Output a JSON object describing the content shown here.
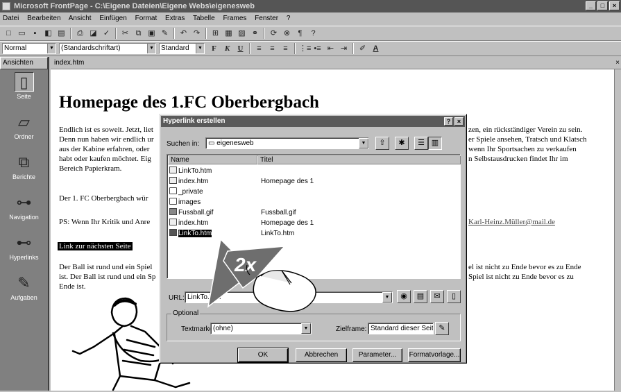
{
  "window": {
    "title": "Microsoft FrontPage - C:\\Eigene Dateien\\Eigene Webs\\eigenesweb",
    "controls": [
      "_",
      "□",
      "×"
    ]
  },
  "menu": [
    "Datei",
    "Bearbeiten",
    "Ansicht",
    "Einfügen",
    "Format",
    "Extras",
    "Tabelle",
    "Frames",
    "Fenster",
    "?"
  ],
  "format_toolbar": {
    "style": "Normal",
    "font": "(Standardschriftart)",
    "size": "Standard",
    "bold": "F",
    "italic": "K",
    "underline": "U"
  },
  "views": {
    "header": "Ansichten",
    "items": [
      {
        "label": "Seite",
        "icon": "page-icon"
      },
      {
        "label": "Ordner",
        "icon": "folder-icon"
      },
      {
        "label": "Berichte",
        "icon": "reports-icon"
      },
      {
        "label": "Navigation",
        "icon": "navigation-icon"
      },
      {
        "label": "Hyperlinks",
        "icon": "hyperlinks-icon"
      },
      {
        "label": "Aufgaben",
        "icon": "tasks-icon"
      }
    ]
  },
  "doc": {
    "tab": "index.htm",
    "close": "×",
    "heading": "Homepage des 1.FC Oberbergbach",
    "p1_left": [
      "Endlich ist es soweit. Jetzt, liet",
      "Denn nun haben wir endlich ur",
      "aus der Kabine erfahren, oder",
      "habt oder kaufen möchtet. Eig",
      "Bereich Papierkram."
    ],
    "p1_right": [
      "zen, ein rückständiger Verein zu sein.",
      "er Spiele ansehen, Tratsch und Klatsch",
      "wenn Ihr Sportsachen zu verkaufen",
      "n Selbstausdrucken findet Ihr im"
    ],
    "p2": "Der 1. FC Oberbergbach wür",
    "p3": "PS: Wenn Ihr Kritik und Anre",
    "email": "Karl-Heinz.Müller@mail.de",
    "selected_link": "Link zur nächsten Seite",
    "p4_left": [
      "Der Ball ist rund und ein Spiel",
      "ist. Der Ball ist rund und ein Sp",
      "Ende ist."
    ],
    "p4_right": [
      "el ist nicht zu Ende bevor es zu Ende",
      "Spiel ist nicht zu Ende bevor es zu"
    ]
  },
  "dialog": {
    "title": "Hyperlink erstellen",
    "help": "?",
    "close": "×",
    "search_label": "Suchen in:",
    "search_value": "eigenesweb",
    "columns": [
      "Name",
      "Titel"
    ],
    "files": [
      {
        "name": "LinkTo.htm",
        "title": "",
        "type": "page"
      },
      {
        "name": "index.htm",
        "title": "Homepage des 1",
        "type": "page"
      },
      {
        "name": "_private",
        "title": "",
        "type": "folder"
      },
      {
        "name": "images",
        "title": "",
        "type": "folder"
      },
      {
        "name": "Fussball.gif",
        "title": "Fussball.gif",
        "type": "image"
      },
      {
        "name": "index.htm",
        "title": "Homepage des 1",
        "type": "page"
      },
      {
        "name": "LinkTo.htm",
        "title": "LinkTo.htm",
        "type": "page",
        "selected": true
      }
    ],
    "url_label": "URL:",
    "url_value": "LinkTo.htm",
    "optional_label": "Optional",
    "bookmark_label": "Textmarke:",
    "bookmark_value": "(ohne)",
    "target_label": "Zielframe:",
    "target_value": "Standard dieser Seit",
    "buttons": {
      "ok": "OK",
      "cancel": "Abbrechen",
      "params": "Parameter...",
      "style": "Formatvorlage..."
    }
  },
  "annotation": {
    "double_click": "2x"
  },
  "colors": {
    "titlebar": "#555555",
    "desktop": "#c0c0c0",
    "views_bg": "#808080",
    "arrow": "#6e6e6e"
  }
}
